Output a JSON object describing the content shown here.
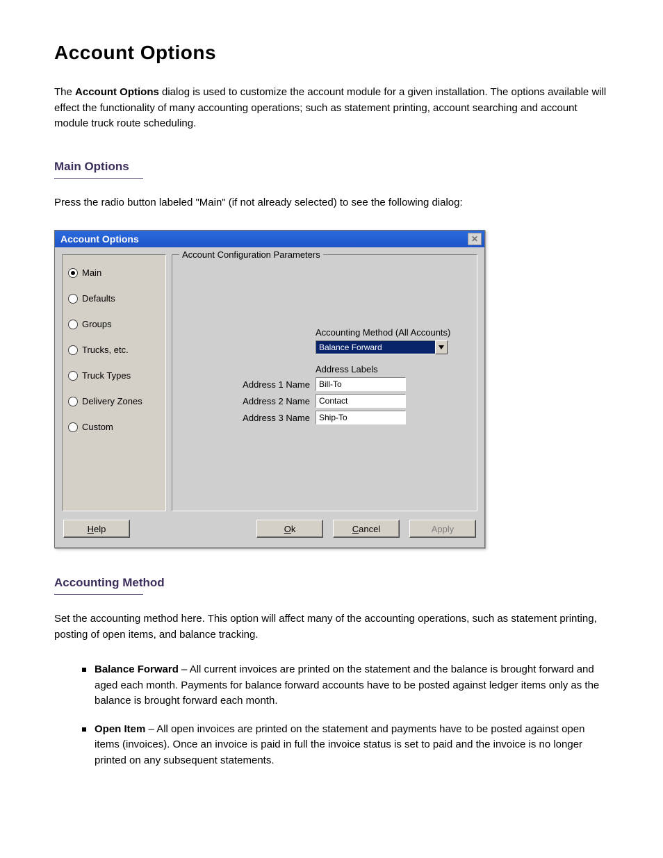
{
  "doc": {
    "title": "Account Options",
    "intro_prefix": "The ",
    "intro_strong": "Account Options",
    "intro_suffix": " dialog is used to customize the account module for a given installation. The options available will effect the functionality of many accounting operations; such as statement printing, account searching and account module truck route scheduling.",
    "sections": {
      "main": {
        "heading": "Main Options",
        "body": "Press the radio button labeled \"Main\" (if not already selected) to see the following dialog:"
      },
      "accounting_method": {
        "heading": "Accounting Method",
        "body": "Set the accounting method here. This option will affect many of the accounting operations, such as statement printing, posting of open items, and balance tracking.",
        "bullets": [
          {
            "strong": "Balance Forward",
            "rest": " – All current invoices are printed on the statement and the balance is brought forward and aged each month. Payments for balance forward accounts have to be posted against ledger items only as the balance is brought forward each month."
          },
          {
            "strong": "Open Item",
            "rest": " – All open invoices are printed on the statement and payments have to be posted against open items (invoices). Once an invoice is paid in full the invoice status is set to paid and the invoice is no longer printed on any subsequent statements."
          }
        ]
      }
    }
  },
  "dialog": {
    "title": "Account Options",
    "close_x": "✕",
    "legend": "Account Configuration Parameters",
    "radios": [
      {
        "label": "Main",
        "checked": true
      },
      {
        "label": "Defaults",
        "checked": false
      },
      {
        "label": "Groups",
        "checked": false
      },
      {
        "label": "Trucks, etc.",
        "checked": false
      },
      {
        "label": "Truck Types",
        "checked": false
      },
      {
        "label": "Delivery Zones",
        "checked": false
      },
      {
        "label": "Custom",
        "checked": false
      }
    ],
    "acct_method_label": "Accounting Method (All Accounts)",
    "acct_method_value": "Balance Forward",
    "address_labels_heading": "Address Labels",
    "addr1_label": "Address 1 Name",
    "addr1_value": "Bill-To",
    "addr2_label": "Address 2 Name",
    "addr2_value": "Contact",
    "addr3_label": "Address 3 Name",
    "addr3_value": "Ship-To",
    "buttons": {
      "help_pre": "",
      "help_m": "H",
      "help_post": "elp",
      "ok_pre": "",
      "ok_m": "O",
      "ok_post": "k",
      "cancel_pre": "",
      "cancel_m": "C",
      "cancel_post": "ancel",
      "apply": "Apply"
    }
  }
}
